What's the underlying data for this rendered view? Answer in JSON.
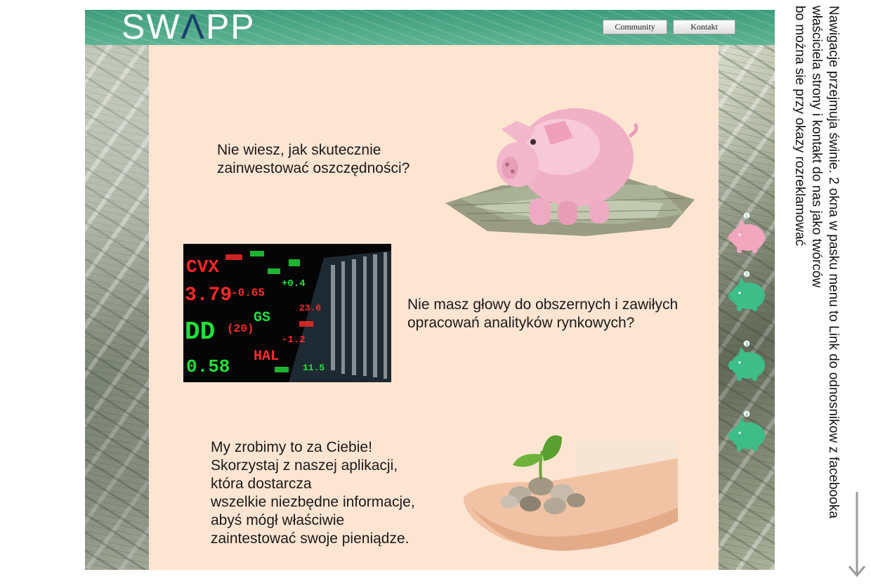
{
  "header": {
    "logo": "SWAPP",
    "nav": [
      {
        "label": "Community"
      },
      {
        "label": "Kontakt"
      }
    ]
  },
  "sections": [
    {
      "text": "Nie wiesz, jak skutecznie\nzainwestować oszczędności?"
    },
    {
      "text": "Nie masz głowy do obszernych i zawiłych\nopracowań analityków rynkowych?"
    },
    {
      "text": "My zrobimy to za Ciebie!\nSkorzystaj z naszej aplikacji,\nktóra dostarcza\nwszelkie niezbędne informacje,\nabyś mógł właściwie\nzaintestować swoje pieniądze."
    }
  ],
  "side_nav": [
    {
      "label": "1",
      "color": "#f2a7bf",
      "active": true
    },
    {
      "label": "2",
      "color": "#3dbd87",
      "active": false
    },
    {
      "label": "3",
      "color": "#3dbd87",
      "active": false
    },
    {
      "label": "4",
      "color": "#3dbd87",
      "active": false
    }
  ],
  "note": "Nawigacje przejmuja świnie. 2 okna w pasku menu to Link do odnosnikow z facebooka\nwłaściciela strony i kontakt do nas jako twórców\nbo można sie przy okazy rozreklamować",
  "colors": {
    "header": "#4fa887",
    "content_bg": "#fde5d2",
    "pig_pink": "#f2a7bf",
    "pig_green": "#3dbd87"
  }
}
